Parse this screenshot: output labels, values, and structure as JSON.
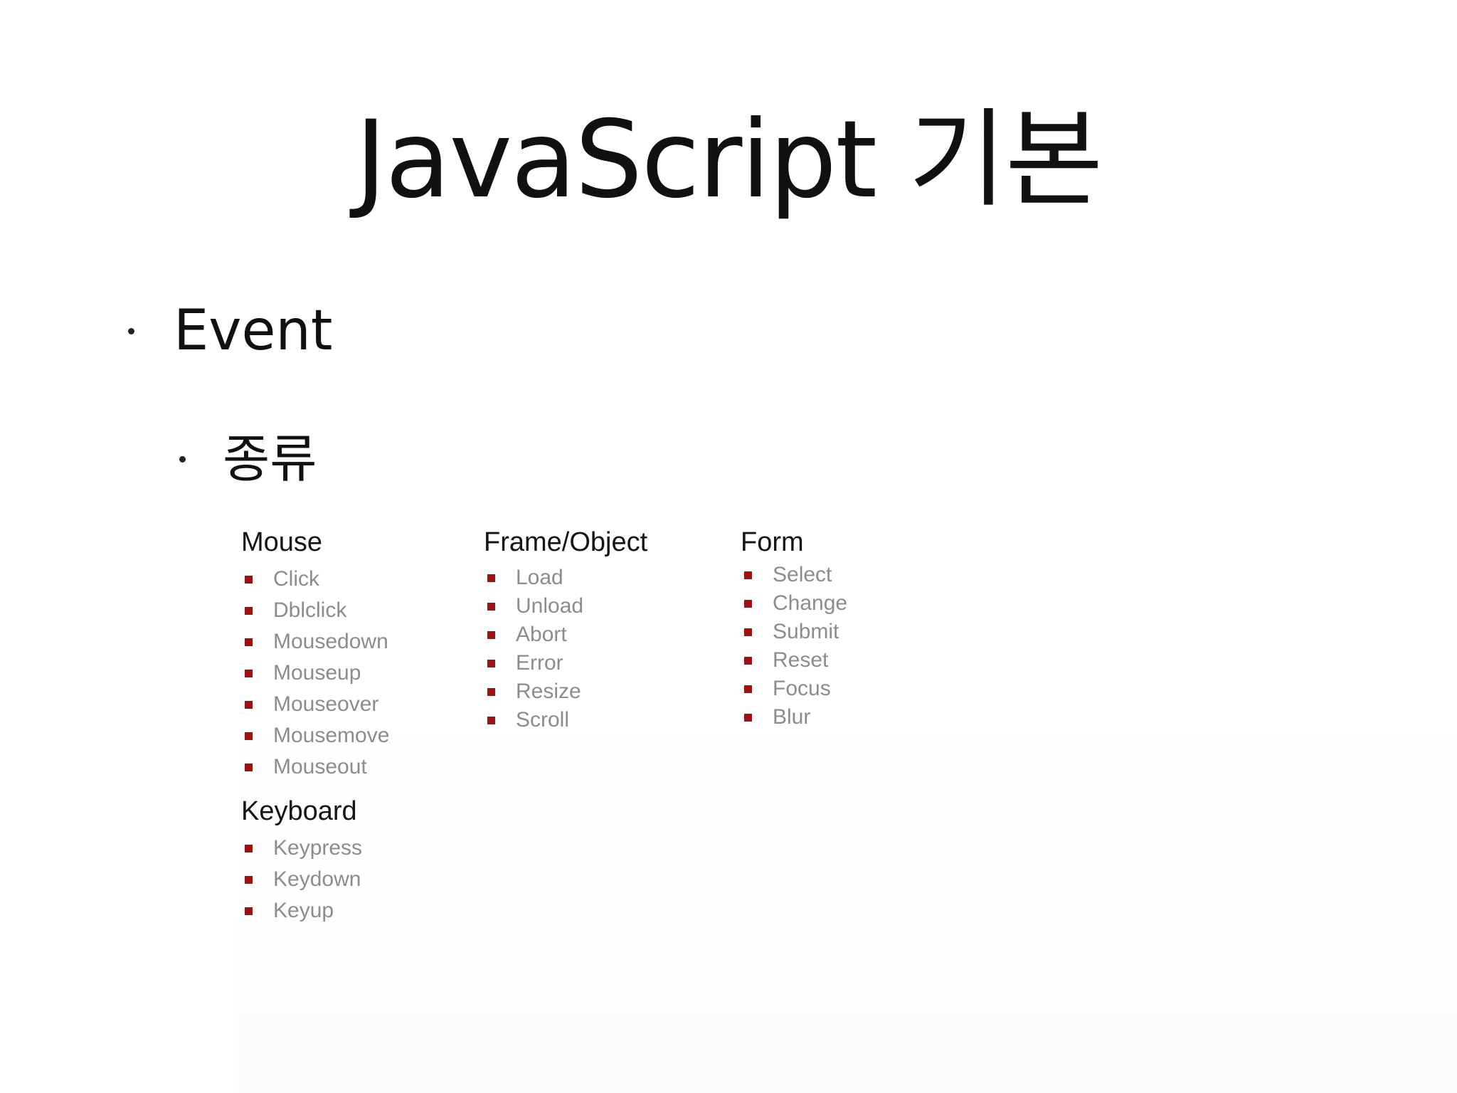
{
  "slide": {
    "title": "JavaScript 기본",
    "bullet_1": "Event",
    "bullet_2": "종류"
  },
  "categories": {
    "mouse": {
      "title": "Mouse",
      "items": [
        "Click",
        "Dblclick",
        "Mousedown",
        "Mouseup",
        "Mouseover",
        "Mousemove",
        "Mouseout"
      ]
    },
    "keyboard": {
      "title": "Keyboard",
      "items": [
        "Keypress",
        "Keydown",
        "Keyup"
      ]
    },
    "frame_object": {
      "title": "Frame/Object",
      "items": [
        "Load",
        "Unload",
        "Abort",
        "Error",
        "Resize",
        "Scroll"
      ]
    },
    "form": {
      "title": "Form",
      "items": [
        "Select",
        "Change",
        "Submit",
        "Reset",
        "Focus",
        "Blur"
      ]
    }
  },
  "colors": {
    "item_marker": "#a01010",
    "item_text": "#8c8c8c",
    "heading_text": "#151515"
  }
}
